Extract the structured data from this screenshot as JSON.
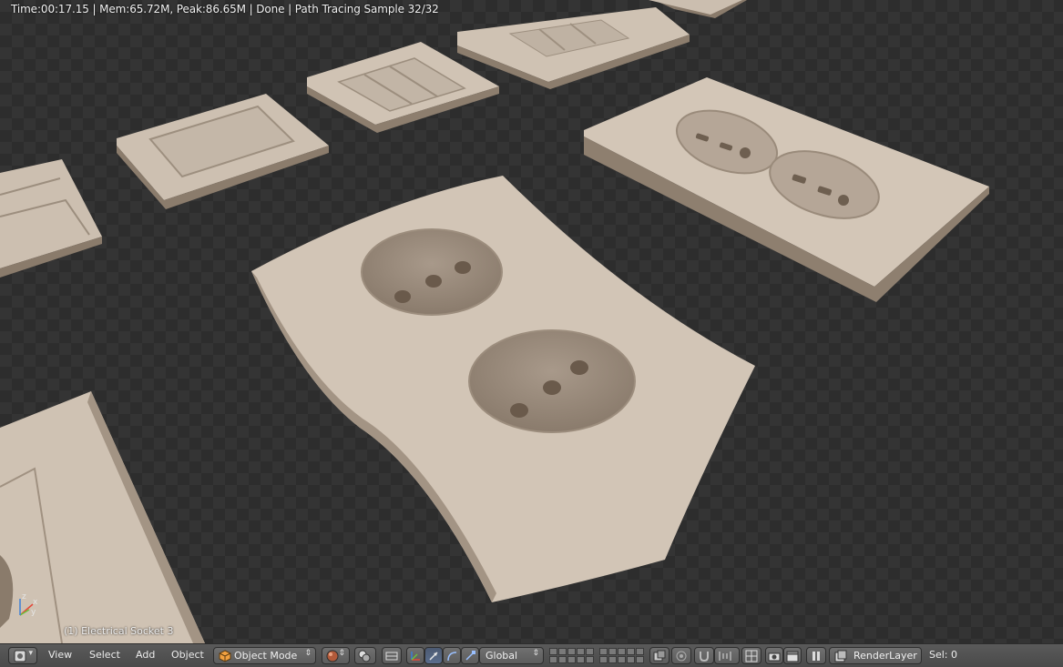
{
  "viewport": {
    "render_status": "Time:00:17.15 | Mem:65.72M, Peak:86.65M | Done | Path Tracing Sample 32/32",
    "active_object_label": "(1) Electrical Socket 3",
    "axis_labels": {
      "x": "x",
      "y": "y",
      "z": "z"
    }
  },
  "header": {
    "menus": [
      "View",
      "Select",
      "Add",
      "Object"
    ],
    "mode": "Object Mode",
    "transform_orientation": "Global",
    "render_layer": "RenderLayer",
    "selection_info": "Sel: 0"
  },
  "icons": {
    "editor_type": "3d-view-icon",
    "mode": "object-cube-icon",
    "shading": "sphere-icon",
    "pivot": "pivot-icon",
    "manipulator": "manipulator-icon",
    "snap": "magnet-icon",
    "render": "camera-icon",
    "render_anim": "clapper-icon"
  },
  "colors": {
    "viewport_bg": "#2f2f2f",
    "header_bg": "#4f4f4f",
    "plastic": "#cdbfae",
    "x_axis": "#e5483a",
    "y_axis": "#6bbf3c",
    "z_axis": "#3b7fd6"
  }
}
